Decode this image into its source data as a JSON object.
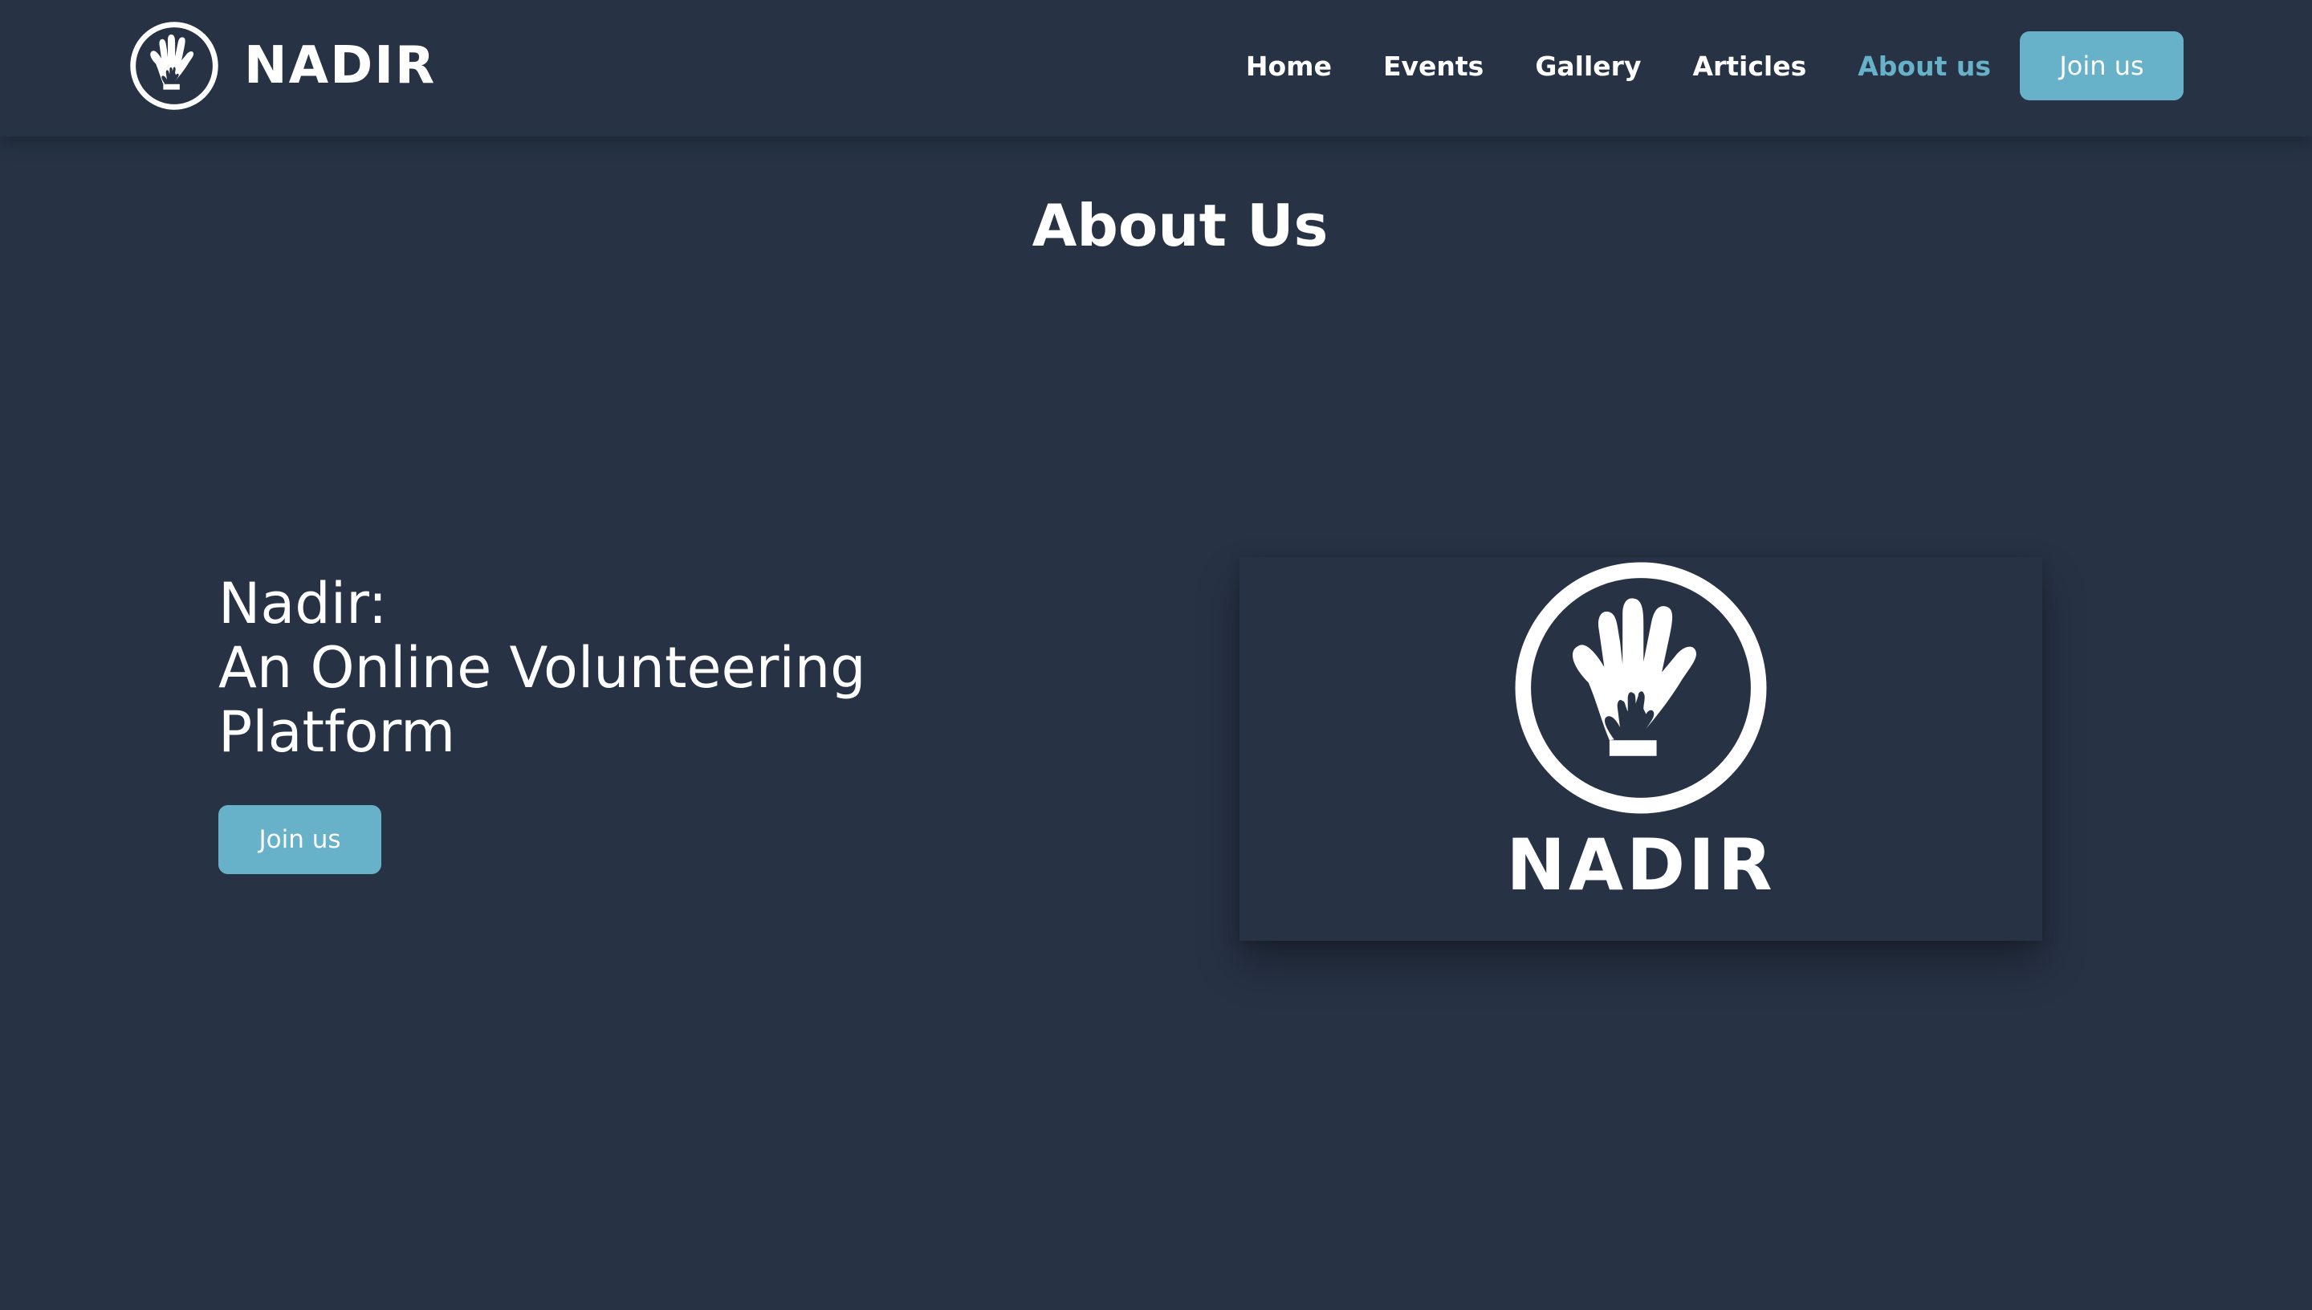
{
  "brand": {
    "name": "NADIR",
    "logo_icon": "hands-in-circle-icon"
  },
  "nav": {
    "items": [
      {
        "label": "Home",
        "active": false
      },
      {
        "label": "Events",
        "active": false
      },
      {
        "label": "Gallery",
        "active": false
      },
      {
        "label": "Articles",
        "active": false
      },
      {
        "label": "About us",
        "active": true
      }
    ],
    "cta_label": "Join us"
  },
  "page": {
    "title": "About Us"
  },
  "hero": {
    "lines": [
      "Nadir:",
      "An Online Volunteering",
      "Platform"
    ],
    "cta_label": "Join us"
  },
  "logo_card": {
    "name": "NADIR",
    "icon": "hands-in-circle-icon"
  },
  "colors": {
    "background": "#273245",
    "accent": "#67b2c9",
    "text": "#ffffff"
  }
}
